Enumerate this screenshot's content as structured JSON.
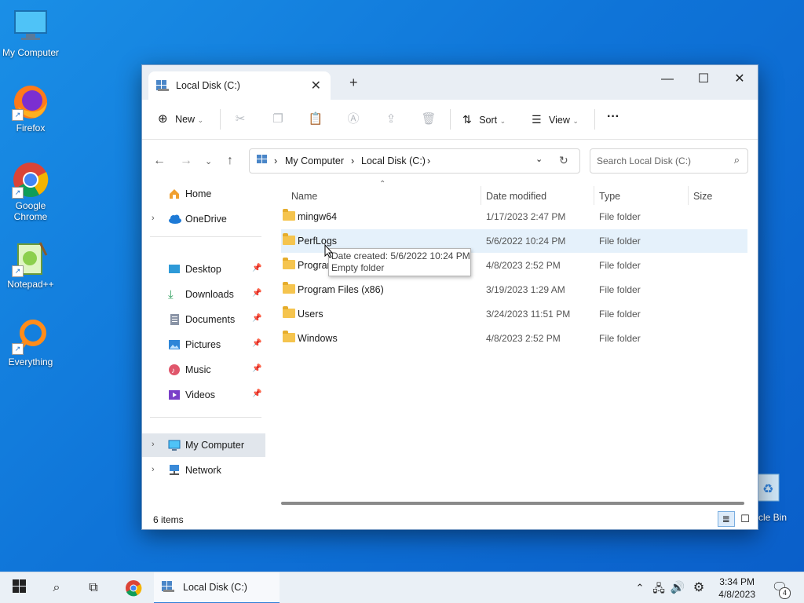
{
  "desktop": {
    "icons": [
      {
        "label": "My Computer"
      },
      {
        "label": "Firefox"
      },
      {
        "label": "Google Chrome"
      },
      {
        "label": "Notepad++"
      },
      {
        "label": "Everything"
      }
    ],
    "recycle_bin": "ycle Bin"
  },
  "window": {
    "tab_title": "Local Disk (C:)",
    "toolbar": {
      "new_label": "New",
      "sort_label": "Sort",
      "view_label": "View",
      "more_label": "···"
    },
    "breadcrumb": [
      "My Computer",
      "Local Disk (C:)"
    ],
    "search_placeholder": "Search Local Disk (C:)",
    "sidebar": {
      "top": [
        {
          "label": "Home",
          "icon": "home-icon"
        },
        {
          "label": "OneDrive",
          "icon": "cloud-icon"
        }
      ],
      "quick": [
        {
          "label": "Desktop",
          "icon": "desktop-icon"
        },
        {
          "label": "Downloads",
          "icon": "download-icon"
        },
        {
          "label": "Documents",
          "icon": "document-icon"
        },
        {
          "label": "Pictures",
          "icon": "picture-icon"
        },
        {
          "label": "Music",
          "icon": "music-icon"
        },
        {
          "label": "Videos",
          "icon": "video-icon"
        }
      ],
      "bottom": [
        {
          "label": "My Computer",
          "icon": "computer-icon"
        },
        {
          "label": "Network",
          "icon": "network-icon"
        }
      ]
    },
    "columns": {
      "name": "Name",
      "date": "Date modified",
      "type": "Type",
      "size": "Size"
    },
    "files": [
      {
        "name": "mingw64",
        "date": "1/17/2023 2:47 PM",
        "type": "File folder"
      },
      {
        "name": "PerfLogs",
        "date": "5/6/2022 10:24 PM",
        "type": "File folder"
      },
      {
        "name": "Program Files",
        "date": "4/8/2023 2:52 PM",
        "type": "File folder"
      },
      {
        "name": "Program Files (x86)",
        "date": "3/19/2023 1:29 AM",
        "type": "File folder"
      },
      {
        "name": "Users",
        "date": "3/24/2023 11:51 PM",
        "type": "File folder"
      },
      {
        "name": "Windows",
        "date": "4/8/2023 2:52 PM",
        "type": "File folder"
      }
    ],
    "tooltip": {
      "line1": "Date created: 5/6/2022 10:24 PM",
      "line2": "Empty folder"
    },
    "status": "6 items"
  },
  "taskbar": {
    "active_task": "Local Disk (C:)",
    "time": "3:34 PM",
    "date": "4/8/2023",
    "notification_count": "4"
  }
}
